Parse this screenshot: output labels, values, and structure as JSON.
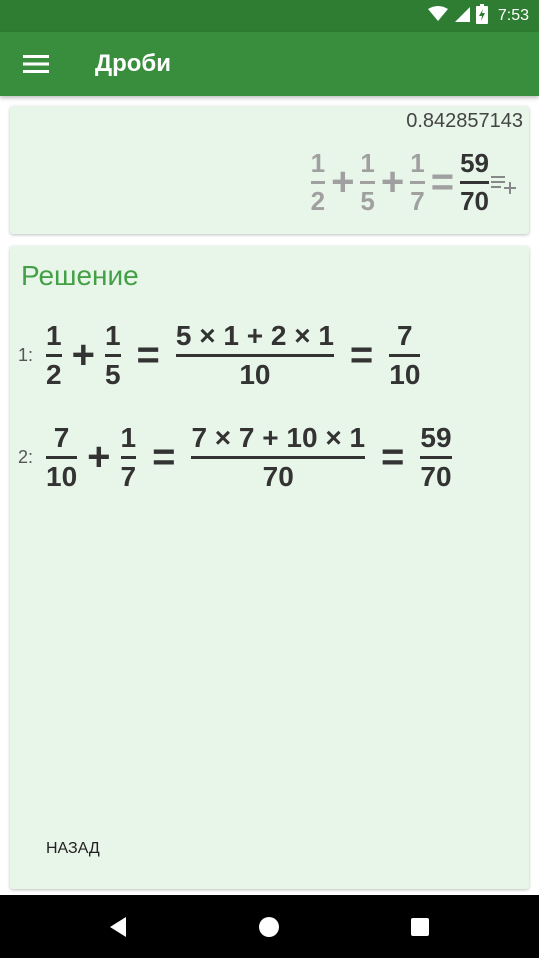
{
  "status_bar": {
    "time": "7:53"
  },
  "app_bar": {
    "title": "Дроби"
  },
  "result": {
    "decimal": "0.842857143",
    "expression": {
      "terms": [
        {
          "num": "1",
          "den": "2"
        },
        {
          "num": "1",
          "den": "5"
        },
        {
          "num": "1",
          "den": "7"
        }
      ],
      "plus": "+",
      "equals": "=",
      "answer": {
        "num": "59",
        "den": "70"
      }
    }
  },
  "solution": {
    "title": "Решение",
    "steps": [
      {
        "label": "1:",
        "a": {
          "num": "1",
          "den": "2"
        },
        "b": {
          "num": "1",
          "den": "5"
        },
        "mid": {
          "num": "5 × 1 + 2 × 1",
          "den": "10"
        },
        "result": {
          "num": "7",
          "den": "10"
        }
      },
      {
        "label": "2:",
        "a": {
          "num": "7",
          "den": "10"
        },
        "b": {
          "num": "1",
          "den": "7"
        },
        "mid": {
          "num": "7 × 7 + 10 × 1",
          "den": "70"
        },
        "result": {
          "num": "59",
          "den": "70"
        }
      }
    ],
    "plus": "+",
    "equals": "=",
    "back_label": "НАЗАД"
  },
  "colors": {
    "status_bar": "#2e7d32",
    "app_bar": "#388e3c",
    "card_bg": "#e8f5e9",
    "accent": "#43a047",
    "muted": "#a0a0a0"
  },
  "icons": [
    "wifi-icon",
    "signal-icon",
    "battery-icon",
    "menu-icon",
    "add-to-history-icon",
    "nav-back-icon",
    "nav-home-icon",
    "nav-recents-icon"
  ]
}
